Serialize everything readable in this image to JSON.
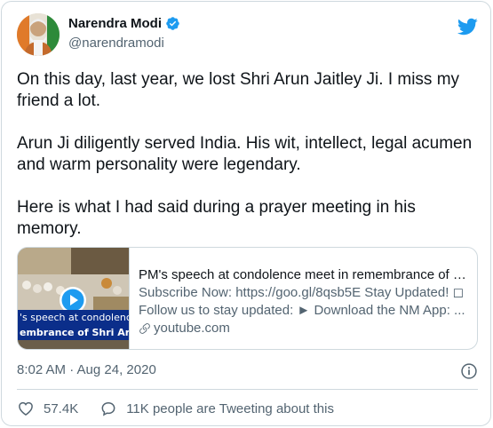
{
  "author": {
    "display_name": "Narendra Modi",
    "handle": "@narendramodi"
  },
  "tweet": {
    "paragraphs": [
      "On this day, last year, we lost Shri Arun Jaitley Ji. I miss my friend a lot.",
      "Arun Ji diligently served India. His wit, intellect, legal acumen and warm personality were legendary.",
      "Here is what I had said during a prayer meeting in his memory."
    ],
    "timestamp": "8:02 AM · Aug 24, 2020"
  },
  "card": {
    "thumbnail_line1": "'s speech at condolence me",
    "thumbnail_line2": "embrance of Shri Arun J",
    "title": "PM's speech at condolence meet in remembrance of S...",
    "desc_line1": "Subscribe Now: https://goo.gl/8qsb5E Stay Updated! ◻",
    "desc_line2": "Follow us to stay updated: ► Download the NM App: ...",
    "domain": "youtube.com"
  },
  "actions": {
    "likes": "57.4K",
    "conversation": "11K people are Tweeting about this"
  },
  "colors": {
    "verified": "#1d9bf0",
    "twitter_brand": "#1d9bf0",
    "thumbnail_banner": "#0b2e8a"
  },
  "icons": [
    "verified-badge-icon",
    "twitter-bird-icon",
    "play-icon",
    "link-icon",
    "info-icon",
    "heart-icon",
    "reply-icon"
  ]
}
